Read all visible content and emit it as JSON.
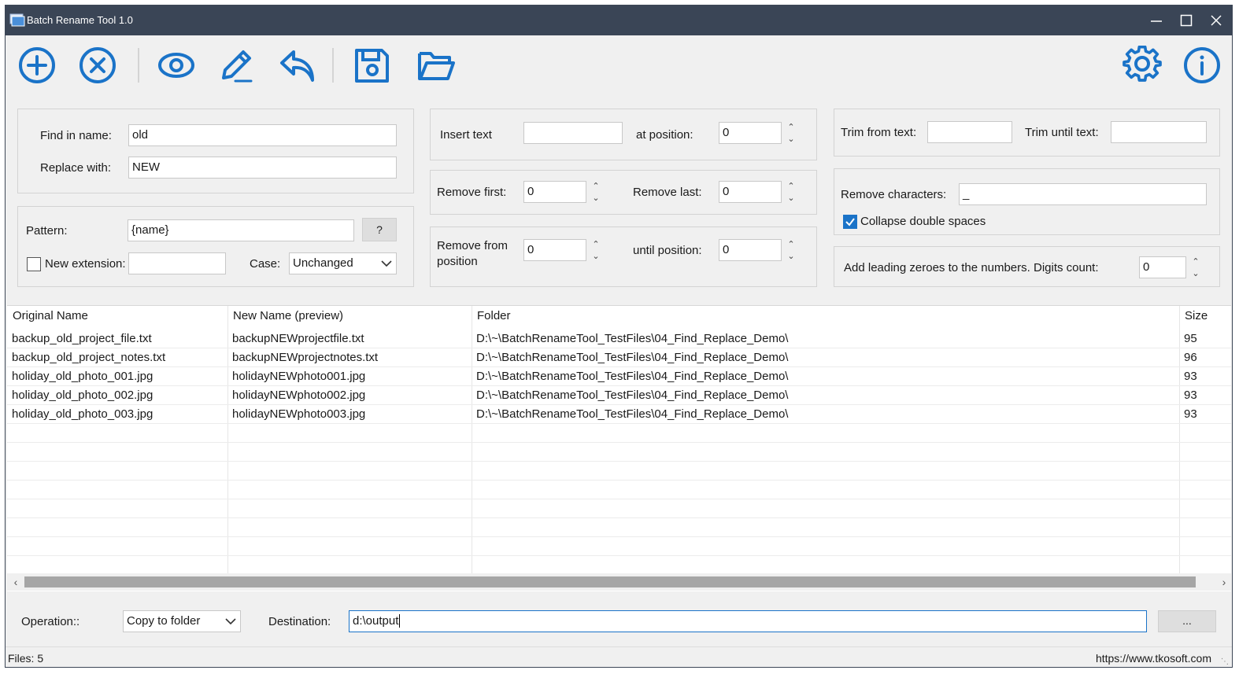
{
  "window": {
    "title": "Batch Rename Tool 1.0"
  },
  "toolbar": {
    "buttons": [
      {
        "name": "add-files",
        "icon": "plus-circle-icon"
      },
      {
        "name": "remove-files",
        "icon": "x-circle-icon"
      },
      {
        "name": "preview",
        "icon": "eye-icon"
      },
      {
        "name": "rename",
        "icon": "pencil-icon"
      },
      {
        "name": "undo",
        "icon": "undo-arrow-icon"
      },
      {
        "name": "save",
        "icon": "floppy-disk-icon"
      },
      {
        "name": "open",
        "icon": "folder-open-icon"
      },
      {
        "name": "settings",
        "icon": "gear-icon"
      },
      {
        "name": "about",
        "icon": "info-circle-icon"
      }
    ]
  },
  "find_replace": {
    "find_label": "Find in name:",
    "find_value": "old",
    "replace_label": "Replace with:",
    "replace_value": "NEW"
  },
  "pattern": {
    "pattern_label": "Pattern:",
    "pattern_value": "{name}",
    "help_label": "?",
    "new_ext_label": "New extension:",
    "new_ext_value": "",
    "case_label": "Case:",
    "case_value": "Unchanged"
  },
  "insert": {
    "insert_label": "Insert text",
    "insert_value": "",
    "position_label": "at position:",
    "position_value": "0"
  },
  "remove_fl": {
    "first_label": "Remove first:",
    "first_value": "0",
    "last_label": "Remove last:",
    "last_value": "0"
  },
  "remove_pos": {
    "from_label_1": "Remove from",
    "from_label_2": "position",
    "from_value": "0",
    "until_label": "until position:",
    "until_value": "0"
  },
  "trim": {
    "from_label": "Trim from text:",
    "from_value": "",
    "until_label": "Trim until text:",
    "until_value": ""
  },
  "remove_chars": {
    "label": "Remove characters:",
    "value": "_",
    "collapse_label": "Collapse double spaces",
    "collapse_checked": true
  },
  "zeroes": {
    "label": "Add leading zeroes to the numbers. Digits count:",
    "value": "0"
  },
  "grid": {
    "columns": [
      "Original Name",
      "New Name (preview)",
      "Folder",
      "Size"
    ],
    "rows": [
      [
        "backup_old_project_file.txt",
        "backupNEWprojectfile.txt",
        "D:\\~\\BatchRenameTool_TestFiles\\04_Find_Replace_Demo\\",
        "95"
      ],
      [
        "backup_old_project_notes.txt",
        "backupNEWprojectnotes.txt",
        "D:\\~\\BatchRenameTool_TestFiles\\04_Find_Replace_Demo\\",
        "96"
      ],
      [
        "holiday_old_photo_001.jpg",
        "holidayNEWphoto001.jpg",
        "D:\\~\\BatchRenameTool_TestFiles\\04_Find_Replace_Demo\\",
        "93"
      ],
      [
        "holiday_old_photo_002.jpg",
        "holidayNEWphoto002.jpg",
        "D:\\~\\BatchRenameTool_TestFiles\\04_Find_Replace_Demo\\",
        "93"
      ],
      [
        "holiday_old_photo_003.jpg",
        "holidayNEWphoto003.jpg",
        "D:\\~\\BatchRenameTool_TestFiles\\04_Find_Replace_Demo\\",
        "93"
      ]
    ]
  },
  "operation": {
    "label": "Operation::",
    "value": "Copy to folder",
    "dest_label": "Destination:",
    "dest_value": "d:\\output",
    "browse_label": "..."
  },
  "status": {
    "files": "Files: 5",
    "url": "https://www.tkosoft.com"
  },
  "colors": {
    "accent": "#1a73c8",
    "titlebar": "#3a4556"
  }
}
